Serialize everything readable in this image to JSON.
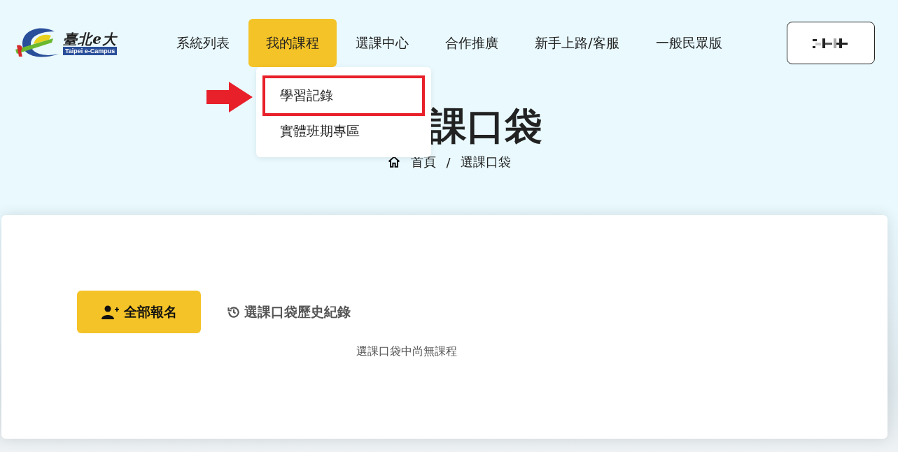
{
  "logo": {
    "title": "臺北e大",
    "subtitle": "Taipei e-Campus"
  },
  "nav": [
    {
      "label": "系統列表",
      "selected": false
    },
    {
      "label": "我的課程",
      "selected": true
    },
    {
      "label": "選課中心",
      "selected": false
    },
    {
      "label": "合作推廣",
      "selected": false
    },
    {
      "label": "新手上路/客服",
      "selected": false
    },
    {
      "label": "一般民眾版",
      "selected": false
    }
  ],
  "dropdown": [
    {
      "label": "學習記錄",
      "highlighted": true
    },
    {
      "label": "實體班期專區",
      "highlighted": false
    }
  ],
  "page_title": "課口袋",
  "breadcrumb": [
    "首頁",
    "/",
    "選課口袋"
  ],
  "enroll_all_button": "全部報名",
  "history_link": "選課口袋歷史紀錄",
  "empty_message": "選課口袋中尚無課程"
}
